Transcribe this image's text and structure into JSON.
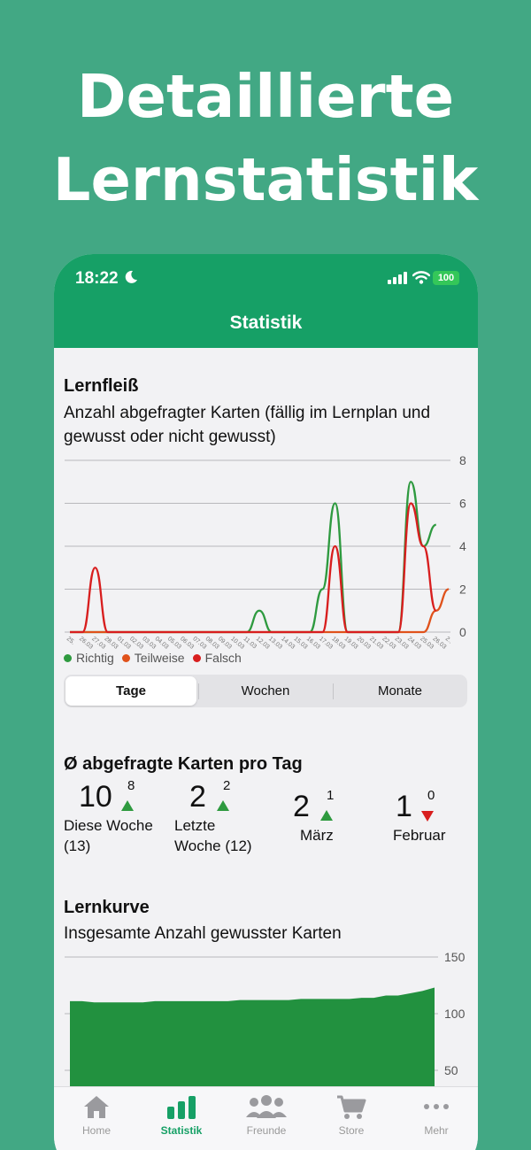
{
  "promo": {
    "headline_line1": "Detaillierte",
    "headline_line2": "Lernstatistik"
  },
  "status_bar": {
    "time": "18:22",
    "battery": "100"
  },
  "nav": {
    "title": "Statistik"
  },
  "lernfleiss": {
    "title": "Lernfleiß",
    "subtitle": "Anzahl abgefragter Karten (fällig im Lernplan und gewusst oder nicht gewusst)"
  },
  "segmented": {
    "options": [
      "Tage",
      "Wochen",
      "Monate"
    ],
    "selected": "Tage"
  },
  "averages": {
    "title": "Ø abgefragte Karten pro Tag",
    "items": [
      {
        "value": "10",
        "delta": "8",
        "trend": "up",
        "label_line1": "Diese Woche",
        "label_line2": "(13)"
      },
      {
        "value": "2",
        "delta": "2",
        "trend": "up",
        "label_line1": "Letzte",
        "label_line2": "Woche (12)"
      },
      {
        "value": "2",
        "delta": "1",
        "trend": "up",
        "label_line1": "März",
        "label_line2": ""
      },
      {
        "value": "1",
        "delta": "0",
        "trend": "down",
        "label_line1": "Februar",
        "label_line2": ""
      }
    ]
  },
  "lernkurve": {
    "title": "Lernkurve",
    "subtitle": "Insgesamte Anzahl gewusster Karten"
  },
  "tabbar": {
    "items": [
      {
        "label": "Home",
        "icon": "home-icon"
      },
      {
        "label": "Statistik",
        "icon": "bar-chart-icon"
      },
      {
        "label": "Freunde",
        "icon": "friends-icon"
      },
      {
        "label": "Store",
        "icon": "cart-icon"
      },
      {
        "label": "Mehr",
        "icon": "more-icon"
      }
    ],
    "active": "Statistik"
  },
  "colors": {
    "brand_green": "#16a066",
    "richtig": "#2e9a3f",
    "teilweise": "#e0521b",
    "falsch": "#d81e1e",
    "lernkurve_fill": "#22913f"
  },
  "chart_data": [
    {
      "type": "line",
      "x": [
        "25.02",
        "26.02",
        "27.02",
        "28.02",
        "01.03",
        "02.03",
        "03.03",
        "04.03",
        "05.03",
        "06.03",
        "07.03",
        "08.03",
        "09.03",
        "10.03",
        "11.03",
        "12.03",
        "13.03",
        "14.03",
        "15.03",
        "16.03",
        "17.03",
        "18.03",
        "19.03",
        "20.03",
        "21.03",
        "22.03",
        "23.03",
        "24.03",
        "25.03",
        "26.03",
        "27.03"
      ],
      "x_ticklabels": [
        "25.",
        "26.03",
        "27.03",
        "28.03",
        "01.03",
        "02.03",
        "03.03",
        "04.03",
        "05.03",
        "06.03",
        "07.03",
        "08.03",
        "09.03",
        "10.03",
        "11.03",
        "12.03",
        "13.03",
        "14.03",
        "15.03",
        "16.03",
        "17.03",
        "18.03",
        "19.03",
        "20.03",
        "21.03",
        "22.03",
        "23.03",
        "24.03",
        "25.03",
        "26.03",
        "2.."
      ],
      "series": [
        {
          "name": "Richtig",
          "values": [
            0,
            0,
            0,
            0,
            0,
            0,
            0,
            0,
            0,
            0,
            0,
            0,
            0,
            0,
            0,
            1,
            0,
            0,
            0,
            0,
            2,
            6,
            0,
            0,
            0,
            0,
            0,
            7,
            4,
            5,
            null
          ]
        },
        {
          "name": "Teilweise",
          "values": [
            0,
            0,
            0,
            0,
            0,
            0,
            0,
            0,
            0,
            0,
            0,
            0,
            0,
            0,
            0,
            0,
            0,
            0,
            0,
            0,
            0,
            0,
            0,
            0,
            0,
            0,
            0,
            0,
            0,
            1,
            2
          ]
        },
        {
          "name": "Falsch",
          "values": [
            0,
            0,
            3,
            0,
            0,
            0,
            0,
            0,
            0,
            0,
            0,
            0,
            0,
            0,
            0,
            0,
            0,
            0,
            0,
            0,
            0,
            4,
            0,
            0,
            0,
            0,
            0,
            6,
            4,
            1,
            null
          ]
        }
      ],
      "ylim": [
        0,
        8
      ],
      "yticks": [
        0,
        2,
        4,
        6,
        8
      ],
      "grid": true,
      "legend": "bottom-left"
    },
    {
      "type": "area",
      "series": [
        {
          "values": [
            111,
            111,
            110,
            110,
            110,
            110,
            110,
            111,
            111,
            111,
            111,
            111,
            111,
            111,
            112,
            112,
            112,
            112,
            112,
            113,
            113,
            113,
            113,
            113,
            114,
            114,
            116,
            116,
            118,
            120,
            123
          ]
        }
      ],
      "ylim_visible": [
        40,
        150
      ],
      "yticks": [
        50,
        100,
        150
      ],
      "grid": true
    }
  ]
}
